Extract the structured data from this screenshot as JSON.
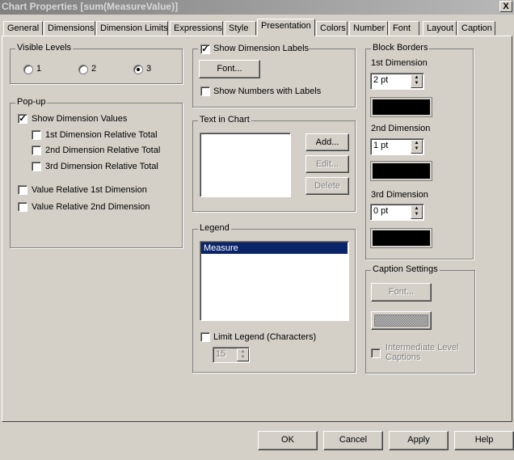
{
  "window": {
    "title": "Chart Properties [sum(MeasureValue)]",
    "close": "X"
  },
  "tabs": [
    "General",
    "Dimensions",
    "Dimension Limits",
    "Expressions",
    "Style",
    "Presentation",
    "Colors",
    "Number",
    "Font",
    "Layout",
    "Caption"
  ],
  "active_tab": "Presentation",
  "visible_levels": {
    "label": "Visible Levels",
    "options": [
      "1",
      "2",
      "3"
    ],
    "selected": "3"
  },
  "popup": {
    "label": "Pop-up",
    "show_dimension_values": "Show Dimension Values",
    "rel1": "1st Dimension Relative Total",
    "rel2": "2nd Dimension Relative Total",
    "rel3": "3rd Dimension Relative Total",
    "val_rel1": "Value Relative 1st Dimension",
    "val_rel2": "Value Relative 2nd Dimension"
  },
  "dim_labels": {
    "label": "Show Dimension Labels",
    "checked": true,
    "font": "Font...",
    "show_numbers": "Show Numbers with Labels"
  },
  "text_in_chart": {
    "label": "Text in Chart",
    "add": "Add...",
    "edit": "Edit...",
    "delete": "Delete"
  },
  "legend": {
    "label": "Legend",
    "items": [
      "Measure"
    ],
    "limit": "Limit Legend (Characters)",
    "limit_value": "15"
  },
  "block_borders": {
    "label": "Block Borders",
    "d1": "1st Dimension",
    "d1_value": "2 pt",
    "d2": "2nd Dimension",
    "d2_value": "1 pt",
    "d3": "3rd Dimension",
    "d3_value": "0 pt",
    "color": "#000000"
  },
  "caption_settings": {
    "label": "Caption Settings",
    "font": "Font...",
    "intermediate": "Intermediate Level Captions"
  },
  "footer": {
    "ok": "OK",
    "cancel": "Cancel",
    "apply": "Apply",
    "help": "Help"
  }
}
